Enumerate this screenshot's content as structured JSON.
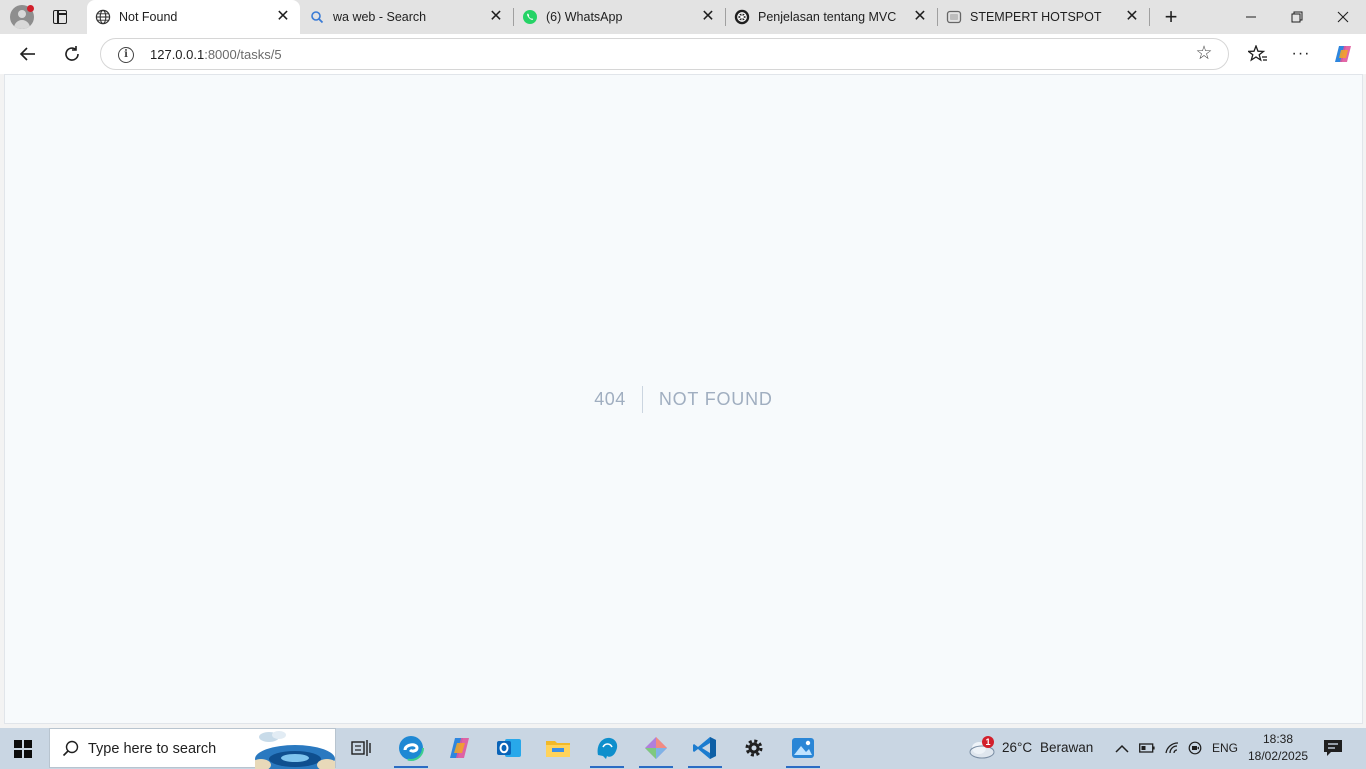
{
  "tabs": [
    {
      "title": "Not Found",
      "icon": "globe-icon",
      "active": true
    },
    {
      "title": "wa web - Search",
      "icon": "search-icon",
      "active": false
    },
    {
      "title": "(6) WhatsApp",
      "icon": "whatsapp-icon",
      "active": false
    },
    {
      "title": "Penjelasan tentang MVC",
      "icon": "chatgpt-icon",
      "active": false
    },
    {
      "title": "STEMPERT HOTSPOT",
      "icon": "page-icon",
      "active": false
    }
  ],
  "address_bar": {
    "host": "127.0.0.1",
    "path": ":8000/tasks/5"
  },
  "page": {
    "status_code": "404",
    "message": "NOT FOUND"
  },
  "taskbar": {
    "search_placeholder": "Type here to search",
    "weather": {
      "temperature": "26°C",
      "condition": "Berawan",
      "badge": "1"
    },
    "language": "ENG",
    "time": "18:38",
    "date": "18/02/2025"
  },
  "colors": {
    "accent": "#2b6cc4",
    "page_bg": "#f7fafc",
    "error_text": "#a0aec0"
  }
}
